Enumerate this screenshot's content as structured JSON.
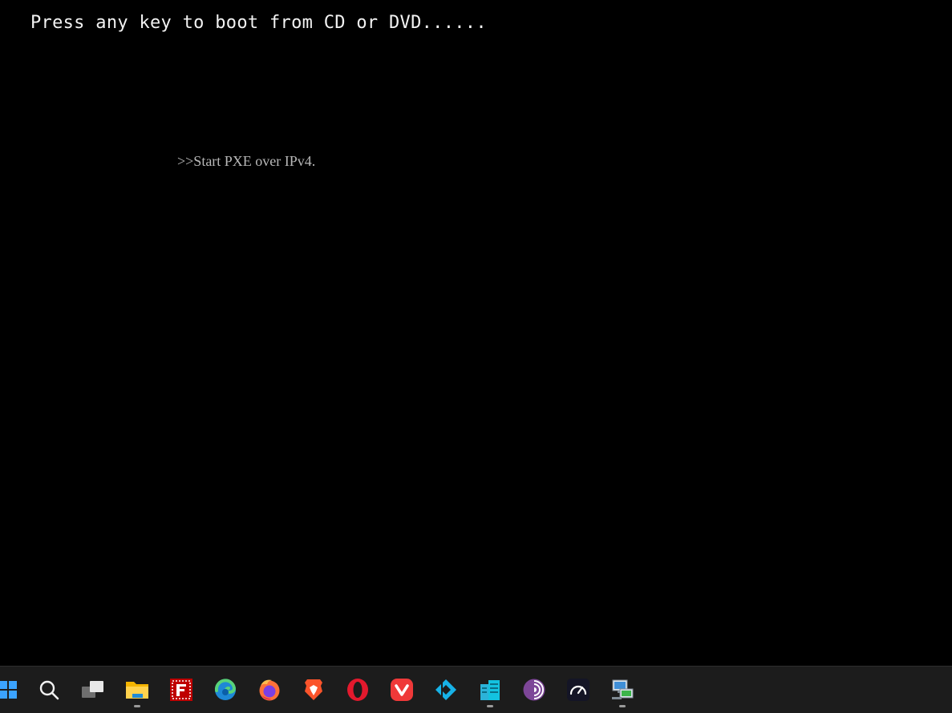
{
  "screen": {
    "boot_prompt": "Press any key to boot from CD or DVD......",
    "pxe_message": ">>Start PXE over IPv4."
  },
  "taskbar": {
    "items": [
      {
        "icon": "windows-start-icon",
        "running": false
      },
      {
        "icon": "search-icon",
        "running": false
      },
      {
        "icon": "task-view-icon",
        "running": false
      },
      {
        "icon": "file-explorer-icon",
        "running": true
      },
      {
        "icon": "filezilla-icon",
        "running": false
      },
      {
        "icon": "edge-icon",
        "running": false
      },
      {
        "icon": "firefox-icon",
        "running": false
      },
      {
        "icon": "brave-icon",
        "running": false
      },
      {
        "icon": "opera-icon",
        "running": false
      },
      {
        "icon": "vivaldi-icon",
        "running": false
      },
      {
        "icon": "kodi-icon",
        "running": false
      },
      {
        "icon": "database-app-icon",
        "running": true
      },
      {
        "icon": "tor-browser-icon",
        "running": false
      },
      {
        "icon": "speedtest-icon",
        "running": false
      },
      {
        "icon": "network-computer-icon",
        "running": true
      }
    ]
  },
  "colors": {
    "boot_text": "#f2f2f2",
    "pxe_text": "#b8b8b8",
    "taskbar_bg": "#1c1c1c",
    "background": "#000000"
  }
}
